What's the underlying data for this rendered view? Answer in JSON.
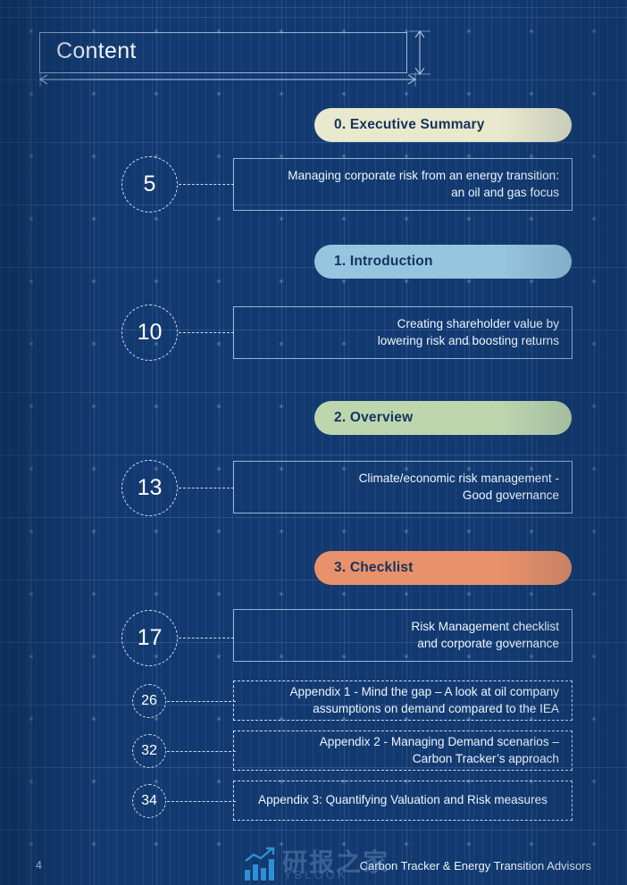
{
  "page": {
    "title": "Content",
    "background_color": "#123a70"
  },
  "sections": [
    {
      "pill_label": "0. Executive Summary",
      "pill_color": "#e8e9cd",
      "page_number": "5",
      "entry_line1": "Managing corporate risk  from an energy transition:",
      "entry_line2": "an oil and gas focus"
    },
    {
      "pill_label": "1. Introduction",
      "pill_color": "#95c5df",
      "page_number": "10",
      "entry_line1": "Creating shareholder value by",
      "entry_line2": "lowering risk and boosting returns"
    },
    {
      "pill_label": "2. Overview",
      "pill_color": "#bdd6ae",
      "page_number": "13",
      "entry_line1": "Climate/economic risk management -",
      "entry_line2": "Good governance"
    },
    {
      "pill_label": "3. Checklist",
      "pill_color": "#e8916a",
      "page_number": "17",
      "entry_line1": "Risk Management checklist",
      "entry_line2": "and corporate governance"
    }
  ],
  "appendices": [
    {
      "page_number": "26",
      "line1": "Appendix 1 - Mind the gap – A look at oil company",
      "line2": "assumptions on demand compared to the IEA"
    },
    {
      "page_number": "32",
      "line1": "Appendix  2 - Managing Demand scenarios –",
      "line2": "Carbon Tracker’s approach"
    },
    {
      "page_number": "34",
      "line1": "Appendix 3: Quantifying Valuation and Risk measures",
      "line2": ""
    }
  ],
  "footer": {
    "page_number": "4",
    "credit": "Carbon Tracker & Energy Transition Advisors"
  },
  "watermark": {
    "chinese_text": "研报之家",
    "latin_text": "YBLOOK"
  }
}
